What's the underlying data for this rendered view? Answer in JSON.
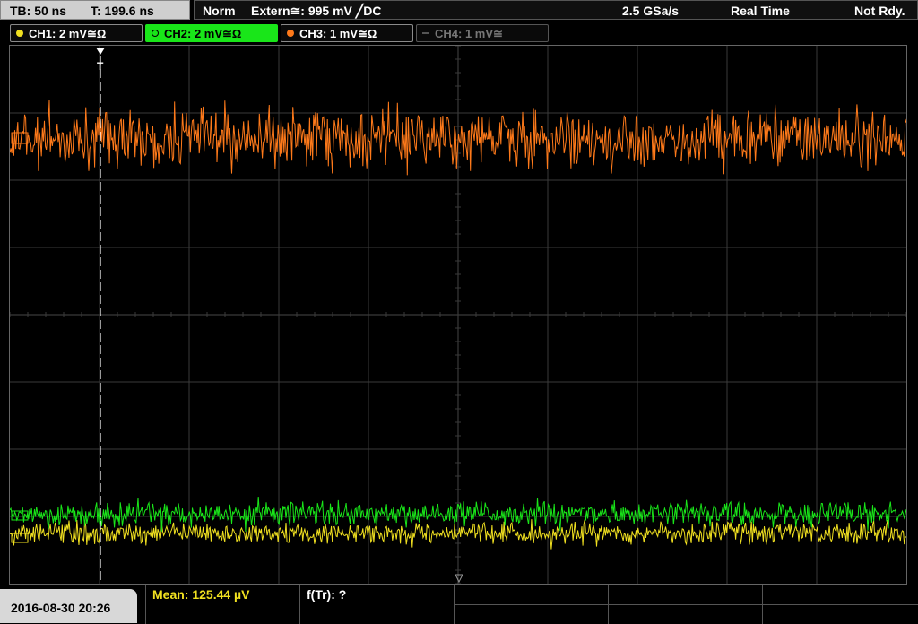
{
  "header": {
    "timebase": "TB: 50 ns",
    "trigger_time": "T: 199.6 ns",
    "trigger_mode": "Norm",
    "trigger_source": "Extern≅: 995 mV ╱DC",
    "sample_rate": "2.5 GSa/s",
    "acquisition_mode": "Real Time",
    "trigger_status": "Not Rdy."
  },
  "channels": [
    {
      "label": "CH1: 2 mV≅Ω",
      "color": "#f0e020",
      "active": true
    },
    {
      "label": "CH2: 2 mV≅Ω",
      "color": "#19e619",
      "active": true,
      "selected": true
    },
    {
      "label": "CH3: 1 mV≅Ω",
      "color": "#ff7a1a",
      "active": true
    },
    {
      "label": "CH4: 1 mV≅",
      "color": "#777777",
      "active": false
    }
  ],
  "measurements": {
    "mean": "Mean: 125.44 µV",
    "frequency": "f(Tr): ?"
  },
  "footer": {
    "datetime": "2016-08-30 20:26"
  },
  "colors": {
    "ch1": "#f0e020",
    "ch2": "#19e619",
    "ch3": "#ff7a1a",
    "grid": "#3a3a3a",
    "trigger_marker": "#ffffff",
    "measure_text": "#f0e020"
  }
}
